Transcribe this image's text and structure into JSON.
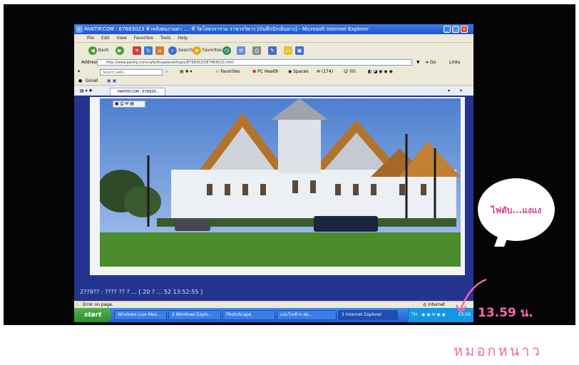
{
  "window": {
    "title": "PANTIP.COM : E7683023 ฟ้าหลังฝนงามตา .... ที่ วัดโสธรราราม ราชวรวิหาร [บันทึกนักเดินทาง] - Microsoft Internet Explorer",
    "minimize_icon": "minimize-icon",
    "maximize_icon": "maximize-icon",
    "close_icon": "close-icon"
  },
  "menu": [
    "File",
    "Edit",
    "View",
    "Favorites",
    "Tools",
    "Help"
  ],
  "toolbar": {
    "back_label": "Back",
    "search_label": "Search",
    "favorites_label": "Favorites"
  },
  "address": {
    "label": "Address",
    "url": "http://www.pantip.com/cafe/blueplanet/topic/E7683023/E7683023.html",
    "go_label": "Go",
    "links_label": "Links"
  },
  "searchbar": {
    "placeholder": "Search web...",
    "favorites_label": "Favorites",
    "pchealth_label": "PC Health",
    "spaces_label": "Spaces",
    "mail_count": "(174)",
    "im_count": "(0)"
  },
  "links": {
    "item1": "Gmail"
  },
  "tab": {
    "label": "PANTIP.COM : E76830..."
  },
  "page": {
    "status_text": "2??9?? : ???? ?? ? ... [ 20 ? ... 52 13:52:55 ]"
  },
  "ie_status": {
    "left": "Error on page.",
    "zone": "Internet"
  },
  "taskbar": {
    "start_label": "start",
    "buttons": [
      "Windows Live Mes...",
      "2 Windows Explo...",
      "PhotoScape",
      "แปะโกเช้าร สด...",
      "3 Internet Explorer"
    ],
    "lang": "TH",
    "clock": "13:59"
  },
  "overlay": {
    "bubble_text": "ไฟดับ...แงแง",
    "time_caption": "13.59 น.",
    "signature": "หมอกหนาว"
  },
  "colors": {
    "accent_pink": "#f06ba8",
    "taskbar_blue": "#1e5fd6",
    "page_background": "#24358f"
  }
}
